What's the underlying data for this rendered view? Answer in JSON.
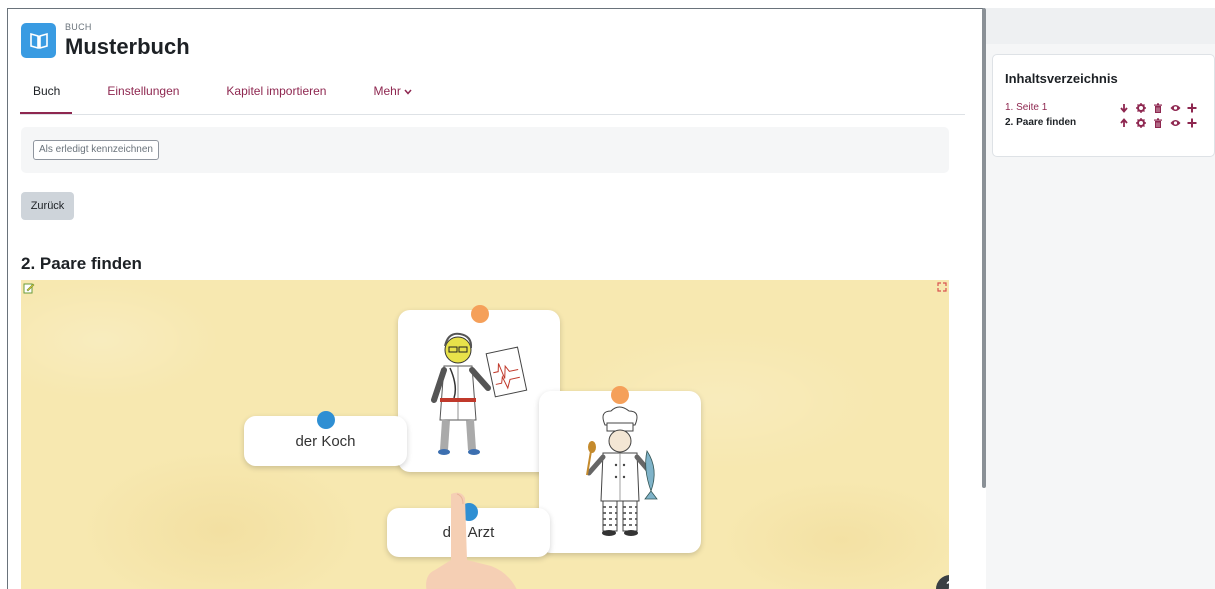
{
  "header": {
    "module_type": "BUCH",
    "title": "Musterbuch",
    "icon": "book-icon",
    "accent": "#399be2"
  },
  "nav": {
    "items": [
      {
        "label": "Buch",
        "active": true
      },
      {
        "label": "Einstellungen",
        "active": false
      },
      {
        "label": "Kapitel importieren",
        "active": false
      },
      {
        "label": "Mehr",
        "active": false
      }
    ],
    "more_icon": "chevron-down-icon",
    "accent": "#8e2750"
  },
  "completion": {
    "button_label": "Als erledigt kennzeichnen"
  },
  "navigation": {
    "back_label": "Zurück"
  },
  "chapter": {
    "title": "2. Paare finden"
  },
  "activity": {
    "word_cards": [
      "der Koch",
      "der Arzt"
    ],
    "image_cards": [
      "doctor-illustration",
      "chef-illustration"
    ],
    "pin_colors": {
      "word": "#2f8fd3",
      "image": "#f5a05a"
    },
    "help_label": "?"
  },
  "toc": {
    "title": "Inhaltsverzeichnis",
    "items": [
      {
        "label": "1. Seite 1",
        "current": false,
        "actions": [
          "arrow-down-icon",
          "gear-icon",
          "trash-icon",
          "eye-icon",
          "plus-icon"
        ]
      },
      {
        "label": "2. Paare finden",
        "current": true,
        "actions": [
          "arrow-up-icon",
          "gear-icon",
          "trash-icon",
          "eye-icon",
          "plus-icon"
        ]
      }
    ]
  }
}
